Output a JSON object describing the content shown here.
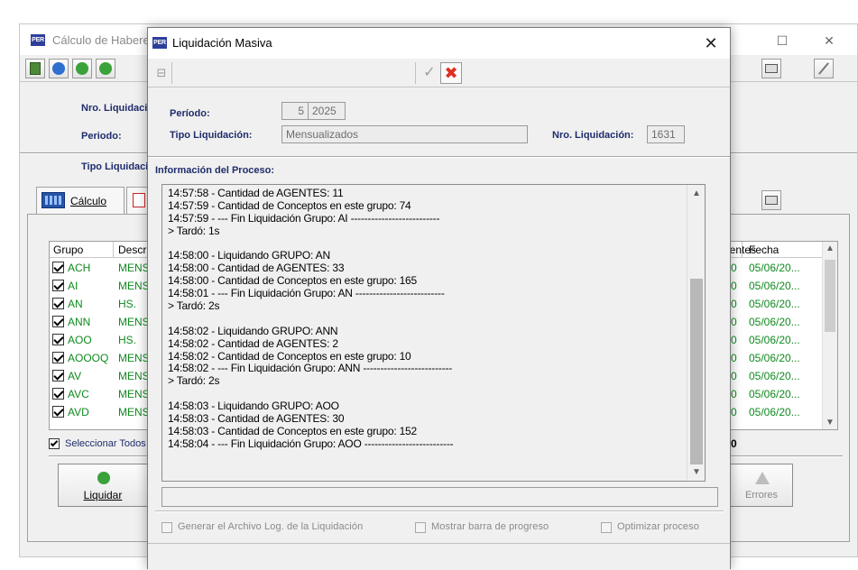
{
  "background_window": {
    "title": "Cálculo de Haberes",
    "labels": {
      "nro_liquidacion": "Nro. Liquidación",
      "periodo": "Periodo:",
      "tipo_liquidacion": "Tipo Liquidación"
    },
    "tabs": {
      "calculo": "Cálculo"
    },
    "grid": {
      "columns": [
        "Grupo",
        "Descripción"
      ],
      "rows": [
        {
          "code": "ACH",
          "desc": "MENSUAL"
        },
        {
          "code": "AI",
          "desc": "MENSUAL"
        },
        {
          "code": "AN",
          "desc": "HS."
        },
        {
          "code": "ANN",
          "desc": "MENSUAL"
        },
        {
          "code": "AOO",
          "desc": "HS."
        },
        {
          "code": "AOOOQ",
          "desc": "MENSUAL"
        },
        {
          "code": "AV",
          "desc": "MENSUAL"
        },
        {
          "code": "AVC",
          "desc": "MENSUAL"
        },
        {
          "code": "AVD",
          "desc": "MENSUAL"
        }
      ]
    },
    "right_grid": {
      "columns": [
        "Agentes",
        "Fecha"
      ],
      "rows": [
        {
          "agentes": "0",
          "fecha": "05/06/20..."
        },
        {
          "agentes": "0",
          "fecha": "05/06/20..."
        },
        {
          "agentes": "0",
          "fecha": "05/06/20..."
        },
        {
          "agentes": "0",
          "fecha": "05/06/20..."
        },
        {
          "agentes": "0",
          "fecha": "05/06/20..."
        },
        {
          "agentes": "0",
          "fecha": "05/06/20..."
        },
        {
          "agentes": "0",
          "fecha": "05/06/20..."
        },
        {
          "agentes": "0",
          "fecha": "05/06/20..."
        },
        {
          "agentes": "0",
          "fecha": "05/06/20..."
        }
      ]
    },
    "select_all_label": "Seleccionar Todos",
    "total_value": "0",
    "buttons": {
      "liquidar": "Liquidar",
      "errores": "Errores"
    }
  },
  "dialog": {
    "title": "Liquidación Masiva",
    "form": {
      "periodo_label": "Período:",
      "periodo_mes": "5",
      "periodo_anio": "2025",
      "tipo_label": "Tipo Liquidación:",
      "tipo_value": "Mensualizados",
      "nro_label": "Nro. Liquidación:",
      "nro_value": "1631"
    },
    "process_title": "Información del Proceso:",
    "log_lines": [
      "14:57:58 - Cantidad de AGENTES: 11",
      "14:57:59 - Cantidad de Conceptos en este grupo:  74",
      "14:57:59 - --- Fin Liquidación Grupo: AI --------------------------",
      "> Tardó: 1s",
      "",
      "14:58:00 - Liquidando GRUPO: AN",
      "14:58:00 - Cantidad de AGENTES: 33",
      "14:58:00 - Cantidad de Conceptos en este grupo:  165",
      "14:58:01 - --- Fin Liquidación Grupo: AN --------------------------",
      "> Tardó: 2s",
      "",
      "14:58:02 - Liquidando GRUPO: ANN",
      "14:58:02 - Cantidad de AGENTES: 2",
      "14:58:02 - Cantidad de Conceptos en este grupo:  10",
      "14:58:02 - --- Fin Liquidación Grupo: ANN --------------------------",
      "> Tardó: 2s",
      "",
      "14:58:03 - Liquidando GRUPO: AOO",
      "14:58:03 - Cantidad de AGENTES: 30",
      "14:58:03 - Cantidad de Conceptos en este grupo:  152",
      "14:58:04 - --- Fin Liquidación Grupo: AOO --------------------------"
    ],
    "options": {
      "generar_log": "Generar el Archivo Log. de la Liquidación",
      "mostrar_barra": "Mostrar barra de progreso",
      "optimizar": "Optimizar proceso"
    }
  },
  "colors": {
    "label_blue": "#1e2c6b",
    "group_green": "#0f8a1e",
    "logo_blue": "#2d3f9a",
    "cancel_red": "#e03020"
  }
}
